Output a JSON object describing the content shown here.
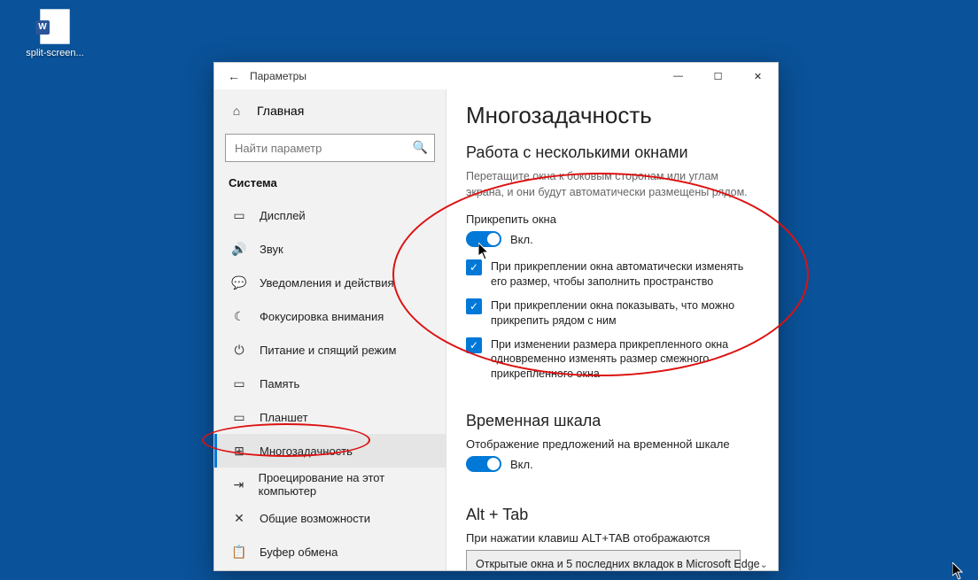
{
  "desktop": {
    "file_label": "split-screen..."
  },
  "window": {
    "title": "Параметры",
    "controls": {
      "minimize": "—",
      "maximize": "☐",
      "close": "✕"
    }
  },
  "sidebar": {
    "home_label": "Главная",
    "search_placeholder": "Найти параметр",
    "section_label": "Система",
    "items": [
      {
        "icon": "display-icon",
        "glyph": "▭",
        "label": "Дисплей"
      },
      {
        "icon": "sound-icon",
        "glyph": "🔊",
        "label": "Звук"
      },
      {
        "icon": "notifications-icon",
        "glyph": "💬",
        "label": "Уведомления и действия"
      },
      {
        "icon": "focus-assist-icon",
        "glyph": "☾",
        "label": "Фокусировка внимания"
      },
      {
        "icon": "power-icon",
        "glyph": "⏻",
        "label": "Питание и спящий режим"
      },
      {
        "icon": "storage-icon",
        "glyph": "▭",
        "label": "Память"
      },
      {
        "icon": "tablet-icon",
        "glyph": "▭",
        "label": "Планшет"
      },
      {
        "icon": "multitasking-icon",
        "glyph": "⊞",
        "label": "Многозадачность"
      },
      {
        "icon": "projecting-icon",
        "glyph": "⇥",
        "label": "Проецирование на этот компьютер"
      },
      {
        "icon": "shared-experiences-icon",
        "glyph": "✕",
        "label": "Общие возможности"
      },
      {
        "icon": "clipboard-icon",
        "glyph": "📋",
        "label": "Буфер обмена"
      }
    ],
    "selected_index": 7
  },
  "content": {
    "page_title": "Многозадачность",
    "snap": {
      "heading": "Работа с несколькими окнами",
      "description": "Перетащите окна к боковым сторонам или углам экрана, и они будут автоматически размещены рядом.",
      "toggle_label": "Прикрепить окна",
      "toggle_state": "Вкл.",
      "options": [
        "При прикреплении окна автоматически изменять его размер, чтобы заполнить пространство",
        "При прикреплении окна показывать, что можно прикрепить рядом с ним",
        "При изменении размера прикрепленного окна одновременно изменять размер смежного прикрепленного окна"
      ]
    },
    "timeline": {
      "heading": "Временная шкала",
      "subheading": "Отображение предложений на временной шкале",
      "toggle_state": "Вкл."
    },
    "alt_tab": {
      "heading": "Alt + Tab",
      "subheading": "При нажатии клавиш ALT+TAB отображаются",
      "dropdown_value": "Открытые окна и 5 последних вкладок в Microsoft Edge"
    }
  }
}
